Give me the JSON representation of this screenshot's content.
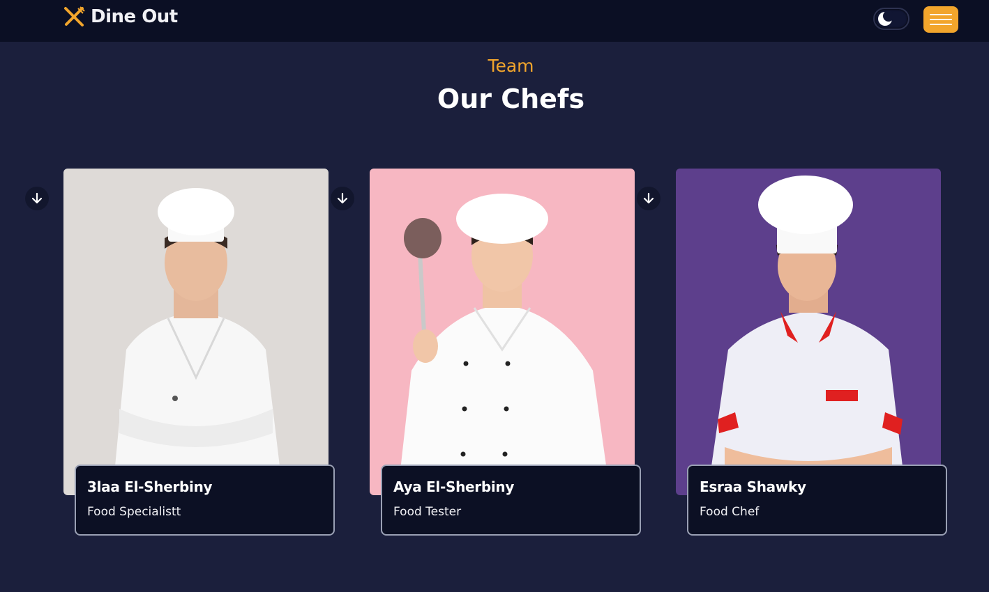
{
  "navbar": {
    "brand": "Dine Out",
    "logo_icon": "fork-knife-icon",
    "theme_icon": "moon-icon",
    "menu_icon": "hamburger-icon",
    "accent_color": "#f2a52c"
  },
  "section": {
    "eyebrow": "Team",
    "title": "Our Chefs"
  },
  "chefs": [
    {
      "name": "3laa El-Sherbiny",
      "role": "Food Specialistt",
      "photo_bg": "#dedad7"
    },
    {
      "name": "Aya El-Sherbiny",
      "role": "Food Tester",
      "photo_bg": "#f7b7c2"
    },
    {
      "name": "Esraa Shawky",
      "role": "Food Chef",
      "photo_bg": "#5d3f8c"
    }
  ]
}
